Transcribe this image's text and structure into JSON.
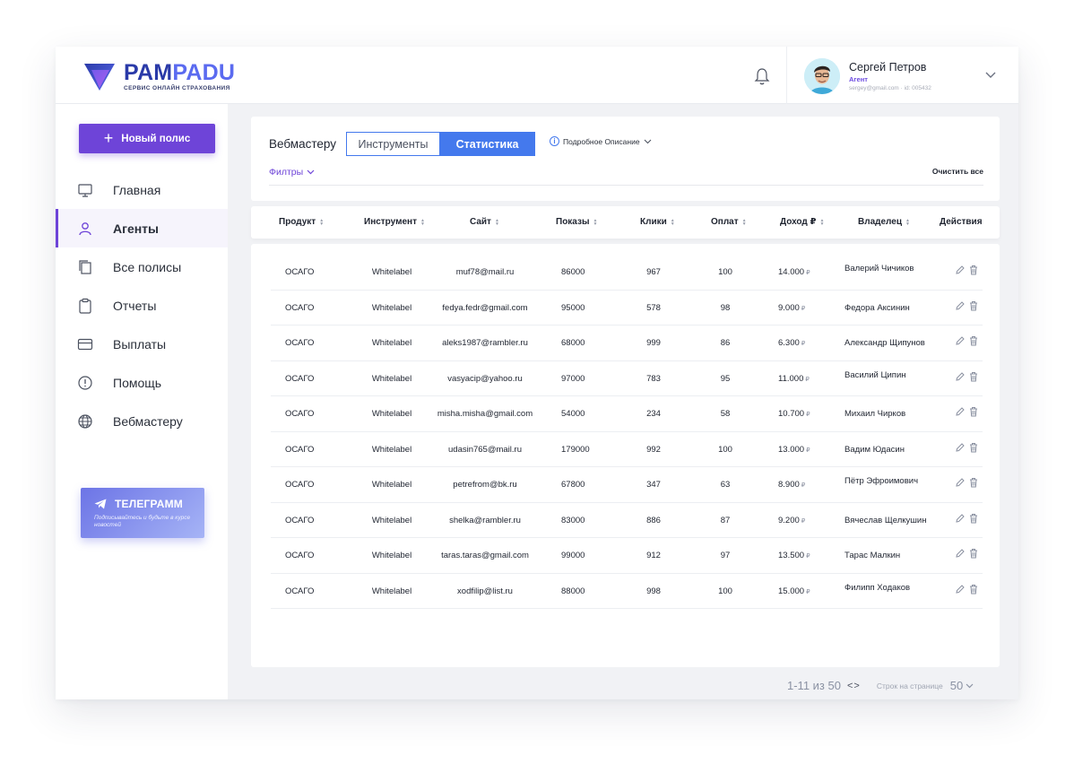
{
  "brand": {
    "name_part1": "PAM",
    "name_part2": "PADU",
    "subtitle": "СЕРВИС ОНЛАЙН СТРАХОВАНИЯ"
  },
  "user": {
    "name": "Сергей Петров",
    "role": "Агент",
    "meta": "sergey@gmail.com · id: 005432"
  },
  "sidebar": {
    "new_button": "Новый полис",
    "items": [
      {
        "label": "Главная",
        "icon": "monitor-icon",
        "active": false
      },
      {
        "label": "Агенты",
        "icon": "user-icon",
        "active": true
      },
      {
        "label": "Все полисы",
        "icon": "copy-icon",
        "active": false
      },
      {
        "label": "Отчеты",
        "icon": "clipboard-icon",
        "active": false
      },
      {
        "label": "Выплаты",
        "icon": "card-icon",
        "active": false
      },
      {
        "label": "Помощь",
        "icon": "alert-circle-icon",
        "active": false
      },
      {
        "label": "Вебмастеру",
        "icon": "globe-icon",
        "active": false
      }
    ],
    "telegram": {
      "title": "ТЕЛЕГРАММ",
      "subtitle": "Подписывайтесь и будьте в курсе новостей"
    }
  },
  "panel": {
    "title": "Вебмастеру",
    "tab_tools": "Инструменты",
    "tab_stats": "Статистика",
    "description": "Подробное Описание",
    "filters": "Филтры",
    "clear_all": "Очистить все"
  },
  "table": {
    "columns": [
      "Продукт",
      "Инструмент",
      "Сайт",
      "Показы",
      "Клики",
      "Оплат",
      "Доход ₽",
      "Владелец",
      "Действия"
    ],
    "rows": [
      {
        "product": "ОСАГО",
        "tool": "Whitelabel",
        "site": "muf78@mail.ru",
        "views": "86000",
        "clicks": "967",
        "paid": "100",
        "income": "14.000",
        "owner": "Валерий Чичиков"
      },
      {
        "product": "ОСАГО",
        "tool": "Whitelabel",
        "site": "fedya.fedr@gmail.com",
        "views": "95000",
        "clicks": "578",
        "paid": "98",
        "income": "9.000",
        "owner": "Федора Аксинин"
      },
      {
        "product": "ОСАГО",
        "tool": "Whitelabel",
        "site": "aleks1987@rambler.ru",
        "views": "68000",
        "clicks": "999",
        "paid": "86",
        "income": "6.300",
        "owner": "Александр Щипунов"
      },
      {
        "product": "ОСАГО",
        "tool": "Whitelabel",
        "site": "vasyacip@yahoo.ru",
        "views": "97000",
        "clicks": "783",
        "paid": "95",
        "income": "11.000",
        "owner": "Василий Ципин"
      },
      {
        "product": "ОСАГО",
        "tool": "Whitelabel",
        "site": "misha.misha@gmail.com",
        "views": "54000",
        "clicks": "234",
        "paid": "58",
        "income": "10.700",
        "owner": "Михаил Чирков"
      },
      {
        "product": "ОСАГО",
        "tool": "Whitelabel",
        "site": "udasin765@mail.ru",
        "views": "179000",
        "clicks": "992",
        "paid": "100",
        "income": "13.000",
        "owner": "Вадим Юдасин"
      },
      {
        "product": "ОСАГО",
        "tool": "Whitelabel",
        "site": "petrefrom@bk.ru",
        "views": "67800",
        "clicks": "347",
        "paid": "63",
        "income": "8.900",
        "owner": "Пётр Эфроимович"
      },
      {
        "product": "ОСАГО",
        "tool": "Whitelabel",
        "site": "shelka@rambler.ru",
        "views": "83000",
        "clicks": "886",
        "paid": "87",
        "income": "9.200",
        "owner": "Вячеслав Щелкушин"
      },
      {
        "product": "ОСАГО",
        "tool": "Whitelabel",
        "site": "taras.taras@gmail.com",
        "views": "99000",
        "clicks": "912",
        "paid": "97",
        "income": "13.500",
        "owner": "Тарас Малкин"
      },
      {
        "product": "ОСАГО",
        "tool": "Whitelabel",
        "site": "xodfilip@list.ru",
        "views": "88000",
        "clicks": "998",
        "paid": "100",
        "income": "15.000",
        "owner": "Филипп Ходаков"
      }
    ],
    "currency": "₽"
  },
  "pagination": {
    "range": "1-11 из 50",
    "arrows": "<>",
    "per_page_label": "Строк на странице",
    "per_page_value": "50"
  },
  "colors": {
    "accent_purple": "#6e44d8",
    "accent_blue": "#4479ed"
  }
}
